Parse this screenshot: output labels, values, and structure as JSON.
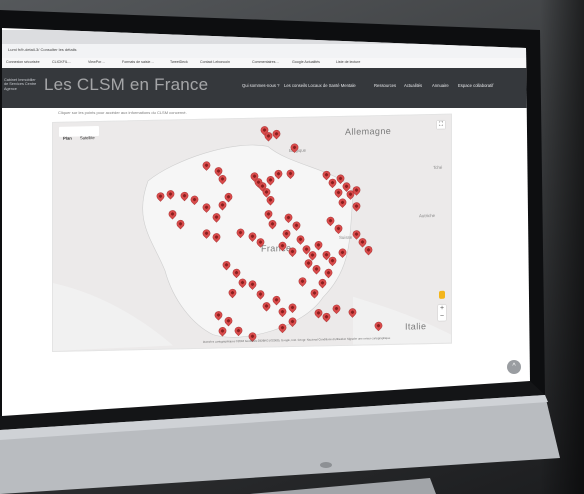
{
  "browser": {
    "url": "Lumi fr/fr-detail-3/ Consulter les détails",
    "bookmarks": [
      "Connexion sécurisée",
      "CLICKFIL…",
      "ViewPor…",
      "Formats de saisie…",
      "TweetDeck",
      "Contact Leboncoin",
      "Commentaires…",
      "Google Actualités",
      "Liste de lecture"
    ]
  },
  "header": {
    "brand": "Cabinet Immobilier\nde Services Centre\nAgence",
    "title": "Les CLSM en France",
    "nav": [
      "Qui sommes-nous ?",
      "Les conseils Locaux de Santé Mentale",
      "Ressources",
      "Actualités",
      "Annuaire",
      "Espace collaboratif"
    ]
  },
  "intro": "Cliquer sur les points pour accéder aux informations du CLSM concerné.",
  "map": {
    "tabs": [
      "Plan",
      "Satellite"
    ],
    "labels": {
      "allemagne": "Allemagne",
      "france": "France",
      "italie": "Italie",
      "belgique": "Belgique",
      "suisse": "Suisse",
      "autriche": "Autriche",
      "tche": "Tché"
    },
    "attribution": "Données cartographiques ©2018 GeoBasis-DE/BKG (©2009), Google, Inst. Geogr. Nacional  Conditions d'utilisation  Signaler une erreur cartographique",
    "zoom_in": "+",
    "zoom_out": "−",
    "fullscreen": "⛶",
    "pin_color": "#d84b4b"
  },
  "scroll_top": "^"
}
